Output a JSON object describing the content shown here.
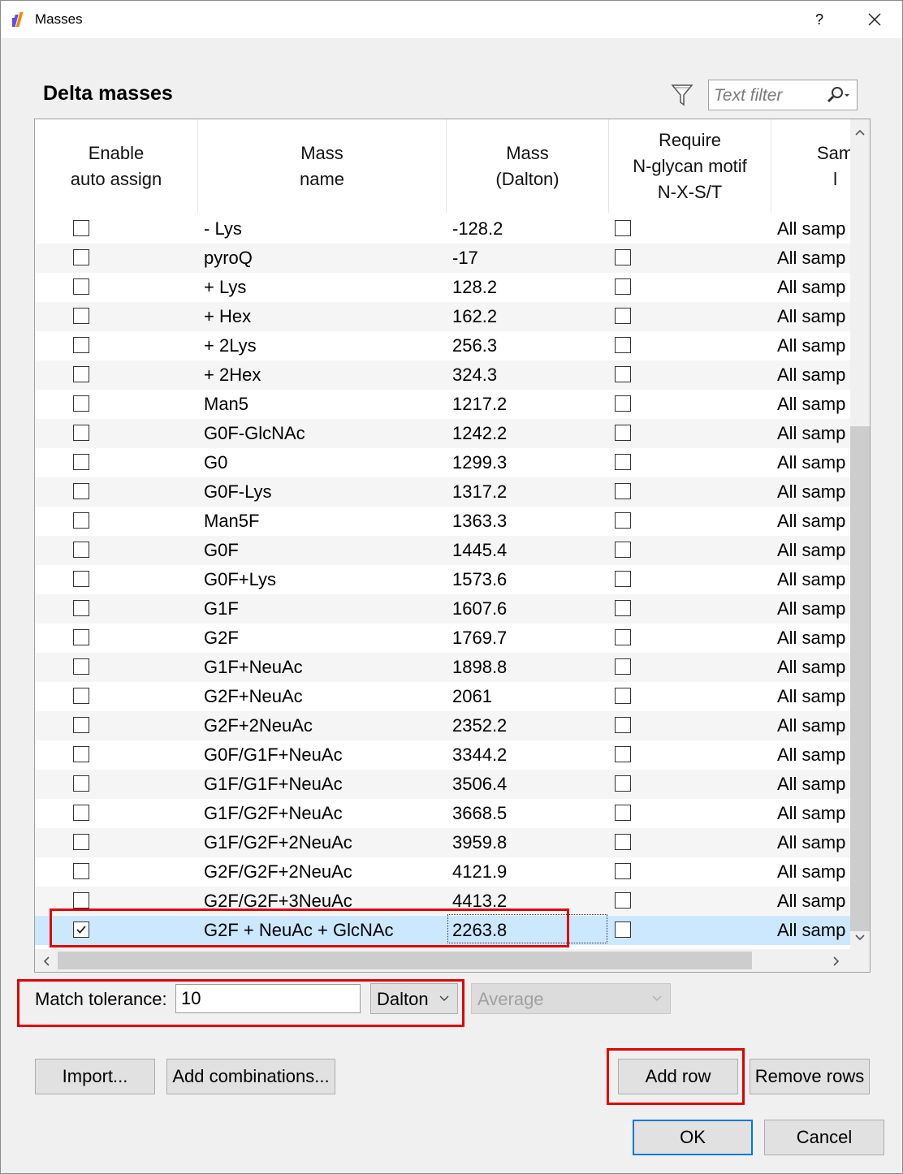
{
  "window": {
    "title": "Masses",
    "help_label": "?"
  },
  "section": {
    "title": "Delta masses"
  },
  "filter": {
    "placeholder": "Text filter"
  },
  "table": {
    "columns": [
      "Enable\nauto assign",
      "Mass\nname",
      "Mass\n(Dalton)",
      "Require\nN-glycan motif\nN-X-S/T",
      "Sam\nl"
    ],
    "rows": [
      {
        "name": "- Lys",
        "mass": "-128.2",
        "enabled": false,
        "require": false,
        "sample": "All samp"
      },
      {
        "name": "pyroQ",
        "mass": "-17",
        "enabled": false,
        "require": false,
        "sample": "All samp"
      },
      {
        "name": "+ Lys",
        "mass": "128.2",
        "enabled": false,
        "require": false,
        "sample": "All samp"
      },
      {
        "name": "+ Hex",
        "mass": "162.2",
        "enabled": false,
        "require": false,
        "sample": "All samp"
      },
      {
        "name": "+ 2Lys",
        "mass": "256.3",
        "enabled": false,
        "require": false,
        "sample": "All samp"
      },
      {
        "name": "+ 2Hex",
        "mass": "324.3",
        "enabled": false,
        "require": false,
        "sample": "All samp"
      },
      {
        "name": "Man5",
        "mass": "1217.2",
        "enabled": false,
        "require": false,
        "sample": "All samp"
      },
      {
        "name": "G0F-GlcNAc",
        "mass": "1242.2",
        "enabled": false,
        "require": false,
        "sample": "All samp"
      },
      {
        "name": "G0",
        "mass": "1299.3",
        "enabled": false,
        "require": false,
        "sample": "All samp"
      },
      {
        "name": "G0F-Lys",
        "mass": "1317.2",
        "enabled": false,
        "require": false,
        "sample": "All samp"
      },
      {
        "name": "Man5F",
        "mass": "1363.3",
        "enabled": false,
        "require": false,
        "sample": "All samp"
      },
      {
        "name": "G0F",
        "mass": "1445.4",
        "enabled": false,
        "require": false,
        "sample": "All samp"
      },
      {
        "name": "G0F+Lys",
        "mass": "1573.6",
        "enabled": false,
        "require": false,
        "sample": "All samp"
      },
      {
        "name": "G1F",
        "mass": "1607.6",
        "enabled": false,
        "require": false,
        "sample": "All samp"
      },
      {
        "name": "G2F",
        "mass": "1769.7",
        "enabled": false,
        "require": false,
        "sample": "All samp"
      },
      {
        "name": "G1F+NeuAc",
        "mass": "1898.8",
        "enabled": false,
        "require": false,
        "sample": "All samp"
      },
      {
        "name": "G2F+NeuAc",
        "mass": "2061",
        "enabled": false,
        "require": false,
        "sample": "All samp"
      },
      {
        "name": "G2F+2NeuAc",
        "mass": "2352.2",
        "enabled": false,
        "require": false,
        "sample": "All samp"
      },
      {
        "name": "G0F/G1F+NeuAc",
        "mass": "3344.2",
        "enabled": false,
        "require": false,
        "sample": "All samp"
      },
      {
        "name": "G1F/G1F+NeuAc",
        "mass": "3506.4",
        "enabled": false,
        "require": false,
        "sample": "All samp"
      },
      {
        "name": "G1F/G2F+NeuAc",
        "mass": "3668.5",
        "enabled": false,
        "require": false,
        "sample": "All samp"
      },
      {
        "name": "G1F/G2F+2NeuAc",
        "mass": "3959.8",
        "enabled": false,
        "require": false,
        "sample": "All samp"
      },
      {
        "name": "G2F/G2F+2NeuAc",
        "mass": "4121.9",
        "enabled": false,
        "require": false,
        "sample": "All samp"
      },
      {
        "name": "G2F/G2F+3NeuAc",
        "mass": "4413.2",
        "enabled": false,
        "require": false,
        "sample": "All samp"
      },
      {
        "name": "G2F + NeuAc + GlcNAc",
        "mass": "2263.8",
        "enabled": true,
        "require": false,
        "sample": "All samp",
        "selected": true
      }
    ]
  },
  "tolerance": {
    "label": "Match tolerance:",
    "value": "10",
    "unit": "Dalton",
    "mode": "Average"
  },
  "buttons": {
    "import": "Import...",
    "add_combinations": "Add combinations...",
    "add_row": "Add row",
    "remove_rows": "Remove rows",
    "ok": "OK",
    "cancel": "Cancel"
  },
  "colors": {
    "highlight": "#e00000",
    "selection": "#cce8ff",
    "default_button_border": "#0078d7"
  }
}
